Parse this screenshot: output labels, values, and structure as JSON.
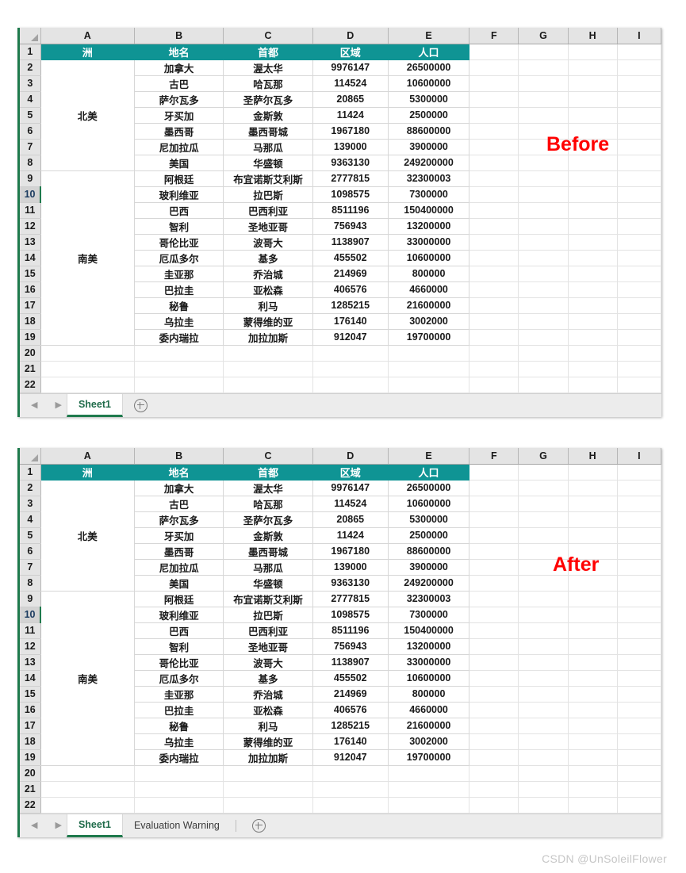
{
  "watermark": "CSDN @UnSoleilFlower",
  "columns": [
    "A",
    "B",
    "C",
    "D",
    "E",
    "F",
    "G",
    "H",
    "I"
  ],
  "row_numbers": [
    "1",
    "2",
    "3",
    "4",
    "5",
    "6",
    "7",
    "8",
    "9",
    "10",
    "11",
    "12",
    "13",
    "14",
    "15",
    "16",
    "17",
    "18",
    "19",
    "20",
    "21",
    "22"
  ],
  "active_row": "10",
  "header_color": "#0f9494",
  "label_color": "#ff0000",
  "sheet_table": {
    "header": [
      "洲",
      "地名",
      "首都",
      "区域",
      "人口"
    ],
    "groups": [
      {
        "continent": "北美",
        "rowspan": 7
      },
      {
        "continent": "南美",
        "rowspan": 11
      }
    ],
    "rows": [
      {
        "row": "2",
        "place": "加拿大",
        "capital": "渥太华",
        "area": "9976147",
        "population": "26500000"
      },
      {
        "row": "3",
        "place": "古巴",
        "capital": "哈瓦那",
        "area": "114524",
        "population": "10600000"
      },
      {
        "row": "4",
        "place": "萨尔瓦多",
        "capital": "圣萨尔瓦多",
        "area": "20865",
        "population": "5300000"
      },
      {
        "row": "5",
        "place": "牙买加",
        "capital": "金斯敦",
        "area": "11424",
        "population": "2500000"
      },
      {
        "row": "6",
        "place": "墨西哥",
        "capital": "墨西哥城",
        "area": "1967180",
        "population": "88600000"
      },
      {
        "row": "7",
        "place": "尼加拉瓜",
        "capital": "马那瓜",
        "area": "139000",
        "population": "3900000"
      },
      {
        "row": "8",
        "place": "美国",
        "capital": "华盛顿",
        "area": "9363130",
        "population": "249200000"
      },
      {
        "row": "9",
        "place": "阿根廷",
        "capital": "布宜诺斯艾利斯",
        "area": "2777815",
        "population": "32300003"
      },
      {
        "row": "10",
        "place": "玻利维亚",
        "capital": "拉巴斯",
        "area": "1098575",
        "population": "7300000"
      },
      {
        "row": "11",
        "place": "巴西",
        "capital": "巴西利亚",
        "area": "8511196",
        "population": "150400000"
      },
      {
        "row": "12",
        "place": "智利",
        "capital": "圣地亚哥",
        "area": "756943",
        "population": "13200000"
      },
      {
        "row": "13",
        "place": "哥伦比亚",
        "capital": "波哥大",
        "area": "1138907",
        "population": "33000000"
      },
      {
        "row": "14",
        "place": "厄瓜多尔",
        "capital": "基多",
        "area": "455502",
        "population": "10600000"
      },
      {
        "row": "15",
        "place": "圭亚那",
        "capital": "乔治城",
        "area": "214969",
        "population": "800000"
      },
      {
        "row": "16",
        "place": "巴拉圭",
        "capital": "亚松森",
        "area": "406576",
        "population": "4660000"
      },
      {
        "row": "17",
        "place": "秘鲁",
        "capital": "利马",
        "area": "1285215",
        "population": "21600000"
      },
      {
        "row": "18",
        "place": "乌拉圭",
        "capital": "蒙得维的亚",
        "area": "176140",
        "population": "3002000"
      },
      {
        "row": "19",
        "place": "委内瑞拉",
        "capital": "加拉加斯",
        "area": "912047",
        "population": "19700000"
      },
      {
        "row": "20",
        "place": "",
        "capital": "",
        "area": "",
        "population": ""
      },
      {
        "row": "21",
        "place": "",
        "capital": "",
        "area": "",
        "population": ""
      },
      {
        "row": "22",
        "place": "",
        "capital": "",
        "area": "",
        "population": ""
      }
    ]
  },
  "panels": [
    {
      "id": "before",
      "label": "Before",
      "tabs": [
        {
          "name": "Sheet1",
          "active": true
        }
      ]
    },
    {
      "id": "after",
      "label": "After",
      "tabs": [
        {
          "name": "Sheet1",
          "active": true
        },
        {
          "name": "Evaluation Warning",
          "active": false
        }
      ]
    }
  ]
}
